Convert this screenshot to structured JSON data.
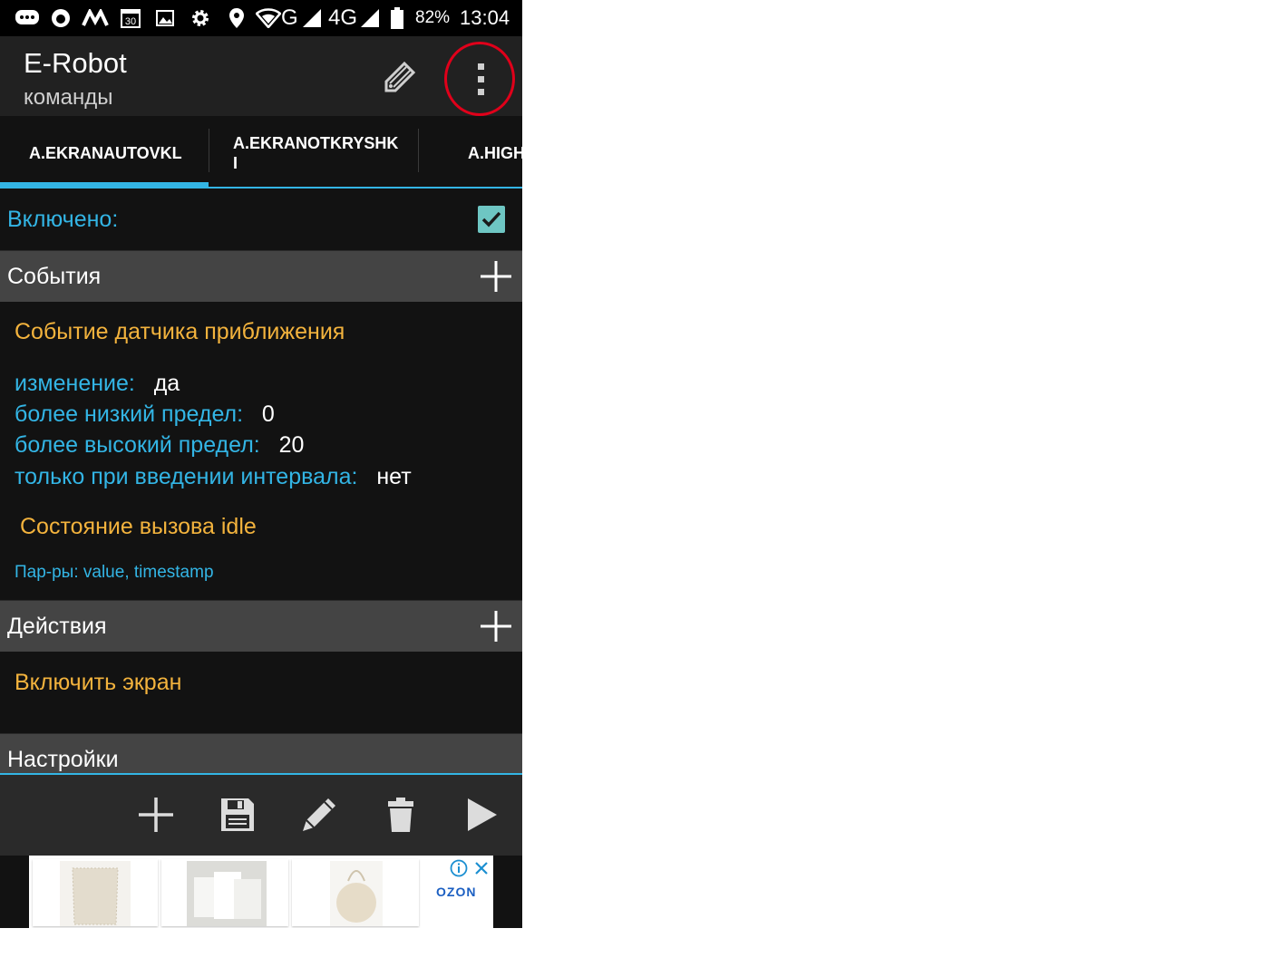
{
  "status_bar": {
    "battery": "82%",
    "time": "13:04",
    "network_g": "G",
    "network_4g": "4G",
    "calendar_day": "30",
    "icons": [
      "chat-icon",
      "circle-notification-icon",
      "m-logo-icon",
      "calendar-icon",
      "image-icon",
      "gear-icon",
      "location-icon",
      "wifi-icon",
      "signal-icon",
      "signal-icon",
      "battery-icon"
    ]
  },
  "app_bar": {
    "title": "E-Robot",
    "subtitle": "команды",
    "icons": [
      "edit-tag-icon",
      "overflow-menu-icon"
    ]
  },
  "tabs": [
    {
      "label": "A.EKRANAUTOVKL",
      "selected": true
    },
    {
      "label": "A.EKRANOTKRYSHK",
      "label_line2": "I",
      "selected": false
    },
    {
      "label": "A.HIGH",
      "selected": false
    }
  ],
  "enabled": {
    "label": "Включено:",
    "checked": true
  },
  "events": {
    "header": "События",
    "event_title": "Событие датчика приближения",
    "params": [
      {
        "name": "изменение:",
        "value": "да"
      },
      {
        "name": "более низкий предел:",
        "value": "0"
      },
      {
        "name": "более высокий предел:",
        "value": "20"
      },
      {
        "name": "только при введении интервала:",
        "value": "нет"
      }
    ],
    "condition": "Состояние вызова idle",
    "parameters": "Пар-ры: value, timestamp"
  },
  "actions": {
    "header": "Действия",
    "items": [
      "Включить экран"
    ]
  },
  "settings": {
    "header": "Настройки"
  },
  "toolbar": {
    "icons": [
      "add-icon",
      "save-icon",
      "edit-icon",
      "trash-icon",
      "play-icon"
    ]
  },
  "ad": {
    "brand": "OZON",
    "icons": [
      "info-icon",
      "close-icon"
    ],
    "colors": {
      "brand": "#1b5fc2"
    }
  },
  "colors": {
    "accent": "#33b5e5",
    "orange": "#f3b33d",
    "header_bg": "#444444",
    "annotation": "#e0001a"
  }
}
